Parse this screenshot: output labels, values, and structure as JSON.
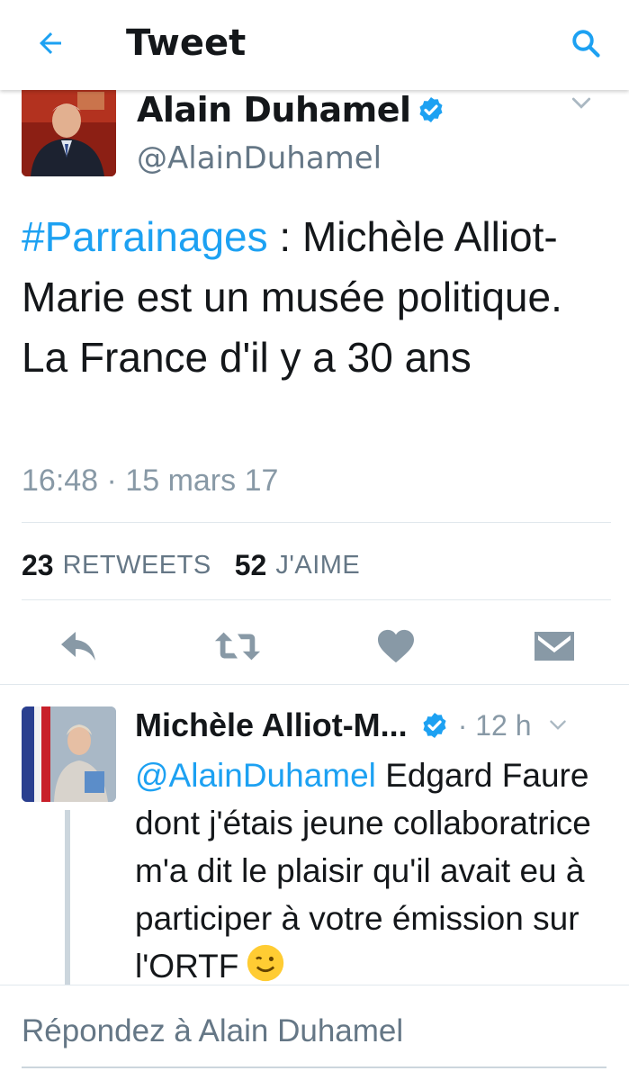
{
  "header": {
    "title": "Tweet",
    "back_icon": "arrow-left-icon",
    "search_icon": "search-icon"
  },
  "tweet": {
    "author_name": "Alain Duhamel",
    "handle": "@AlainDuhamel",
    "hashtag": "#Parrainages",
    "text": " : Michèle Alliot-Marie est un musée politique. La France d'il y a 30 ans",
    "timestamp": "16:48 · 15 mars 17",
    "retweets_count": "23",
    "retweets_label": "RETWEETS",
    "likes_count": "52",
    "likes_label": "J'AIME"
  },
  "actions": [
    {
      "name": "reply",
      "icon": "reply-icon"
    },
    {
      "name": "retweet",
      "icon": "retweet-icon"
    },
    {
      "name": "like",
      "icon": "heart-icon"
    },
    {
      "name": "message",
      "icon": "envelope-icon"
    }
  ],
  "reply": {
    "author_name": "Michèle Alliot-M...",
    "time": "· 12 h",
    "mention": "@AlainDuhamel",
    "text": " Edgard Faure dont j'étais jeune collaboratrice m'a dit le plaisir qu'il avait eu à participer à votre émission sur l'ORTF"
  },
  "composer": {
    "placeholder": "Répondez à Alain Duhamel"
  },
  "colors": {
    "accent": "#1da1f2",
    "text_primary": "#14171a",
    "text_secondary": "#657786",
    "icon_gray": "#8899a6",
    "divider": "#e1e8ed"
  }
}
